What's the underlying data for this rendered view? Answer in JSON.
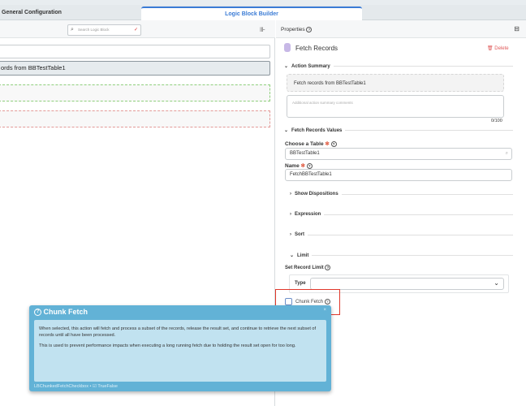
{
  "tabs": [
    {
      "label": "General Configuration"
    },
    {
      "label": "Logic Block Builder"
    }
  ],
  "toolbar": {
    "search_placeholder": "Search Logic Block"
  },
  "canvas": {
    "selected_block_text": "ords from BBTestTable1"
  },
  "properties": {
    "title": "Properties",
    "action_title": "Fetch Records",
    "delete_label": "Delete",
    "action_summary_label": "Action Summary",
    "summary_text": "Fetch records from BBTestTable1",
    "comments_placeholder": "Additional action summary comments",
    "char_count": "0/100",
    "values_label": "Fetch Records Values",
    "table_label": "Choose a Table",
    "table_value": "BBTestTable1",
    "name_label": "Name",
    "name_value": "FetchBBTestTable1",
    "show_dispositions": "Show Dispositions",
    "expression": "Expression",
    "sort": "Sort",
    "limit": "Limit",
    "set_record_limit": "Set Record Limit",
    "type_label": "Type",
    "type_value": "",
    "chunk_fetch_label": "Chunk Fetch",
    "chunk_fetch_checked": false
  },
  "popup": {
    "title": "Chunk Fetch",
    "para1": "When selected, this action will fetch and process a subset of the records, release the result set, and continue to retrieve the next subset of records until all have been processed.",
    "para2": "This is used to prevent performance impacts when executing a long running fetch due to holding the result set open for too long.",
    "field_id": "LBChunkedFetchCheckbox",
    "sep": "•",
    "field_type": "TrueFalse"
  },
  "colors": {
    "accent": "#3a7bd5",
    "highlight": "#e0382b",
    "popup": "#62b2d6"
  }
}
